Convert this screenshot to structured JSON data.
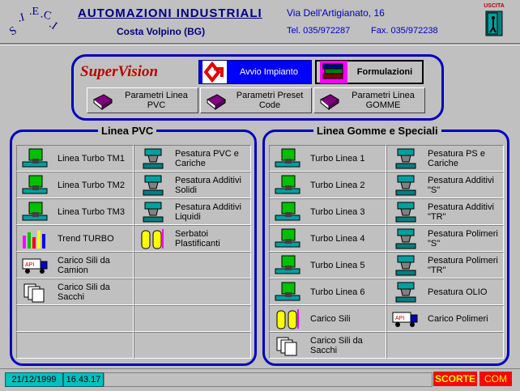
{
  "header": {
    "logo_text": "S.I.E.C.I.",
    "company": "AUTOMAZIONI  INDUSTRIALI",
    "location": "Costa Volpino  (BG)",
    "address": "Via Dell'Artigianato, 16",
    "tel": "Tel.  035/972287",
    "fax": "Fax.  035/972238",
    "exit_label": "USCITA"
  },
  "top": {
    "brand": "SuperVision",
    "avvio": "Avvio Impianto",
    "formulazioni": "Formulazioni",
    "params": [
      "Parametri Linea PVC",
      "Parametri Preset Code",
      "Parametri Linea GOMME"
    ]
  },
  "pvc": {
    "title": "Linea PVC",
    "cells": [
      {
        "label": "Linea Turbo TM1",
        "icon": "turbo-icon"
      },
      {
        "label": "Pesatura PVC e Cariche",
        "icon": "scale-icon"
      },
      {
        "label": "Linea Turbo TM2",
        "icon": "turbo-icon"
      },
      {
        "label": "Pesatura Additivi Solidi",
        "icon": "scale-icon"
      },
      {
        "label": "Linea Turbo TM3",
        "icon": "turbo-icon"
      },
      {
        "label": "Pesatura Additivi Liquidi",
        "icon": "scale-icon"
      },
      {
        "label": "Trend  TURBO",
        "icon": "trend-icon"
      },
      {
        "label": "Serbatoi Plastificanti",
        "icon": "tank-icon"
      },
      {
        "label": "Carico Sili da Camion",
        "icon": "truck-icon"
      },
      {
        "label": "",
        "icon": ""
      },
      {
        "label": "Carico Sili da Sacchi",
        "icon": "bags-icon"
      },
      {
        "label": "",
        "icon": ""
      },
      {
        "label": "",
        "icon": ""
      },
      {
        "label": "",
        "icon": ""
      },
      {
        "label": "",
        "icon": ""
      },
      {
        "label": "",
        "icon": ""
      }
    ]
  },
  "gomme": {
    "title": "Linea Gomme e Speciali",
    "cells": [
      {
        "label": "Turbo Linea 1",
        "icon": "turbo-icon"
      },
      {
        "label": "Pesatura PS e Cariche",
        "icon": "scale-icon"
      },
      {
        "label": "Turbo Linea 2",
        "icon": "turbo-icon"
      },
      {
        "label": "Pesatura Additivi \"S\"",
        "icon": "scale-icon"
      },
      {
        "label": "Turbo Linea 3",
        "icon": "turbo-icon"
      },
      {
        "label": "Pesatura Additivi \"TR\"",
        "icon": "scale-icon"
      },
      {
        "label": "Turbo Linea 4",
        "icon": "turbo-icon"
      },
      {
        "label": "Pesatura Polimeri \"S\"",
        "icon": "scale-icon"
      },
      {
        "label": "Turbo Linea 5",
        "icon": "turbo-icon"
      },
      {
        "label": "Pesatura Polimeri \"TR\"",
        "icon": "scale-icon"
      },
      {
        "label": "Turbo Linea 6",
        "icon": "turbo-icon"
      },
      {
        "label": "Pesatura OLIO",
        "icon": "scale-icon"
      },
      {
        "label": "Carico Sili",
        "icon": "tank-icon"
      },
      {
        "label": "Carico Polimeri",
        "icon": "truck-icon"
      },
      {
        "label": "Carico Sili da Sacchi",
        "icon": "bags-icon"
      },
      {
        "label": "",
        "icon": ""
      }
    ]
  },
  "status": {
    "date": "21/12/1999",
    "time": "16.43.17",
    "scorte": "SCORTE",
    "com": "COM"
  }
}
